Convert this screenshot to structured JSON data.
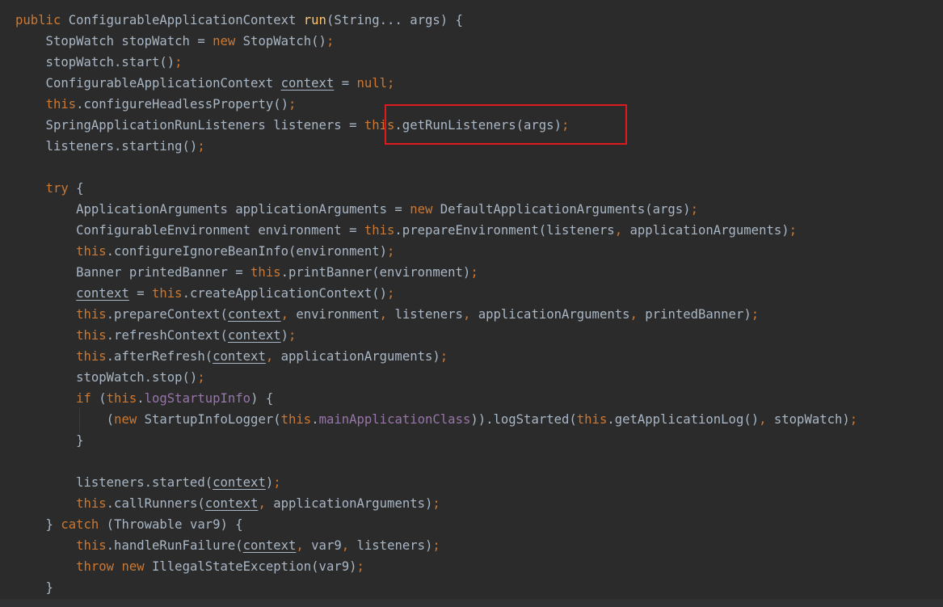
{
  "editor": {
    "highlight_color": "#e0191e",
    "colors": {
      "background": "#2b2b2b",
      "text": "#a9b7c6",
      "keyword": "#cc7832",
      "method_declaration": "#ffc66d",
      "field": "#9876aa"
    },
    "lines": [
      [
        {
          "t": "public",
          "c": "kw"
        },
        {
          "t": " ConfigurableApplicationContext "
        },
        {
          "t": "run",
          "c": "fn"
        },
        {
          "t": "(String... args) {"
        }
      ],
      [
        {
          "t": "    StopWatch stopWatch = "
        },
        {
          "t": "new",
          "c": "kw"
        },
        {
          "t": " StopWatch()"
        },
        {
          "t": ";",
          "c": "kw"
        }
      ],
      [
        {
          "t": "    stopWatch.start()"
        },
        {
          "t": ";",
          "c": "kw"
        }
      ],
      [
        {
          "t": "    ConfigurableApplicationContext "
        },
        {
          "t": "context",
          "c": "ul"
        },
        {
          "t": " = "
        },
        {
          "t": "null;",
          "c": "kw"
        }
      ],
      [
        {
          "t": "    "
        },
        {
          "t": "this",
          "c": "kw"
        },
        {
          "t": ".configureHeadlessProperty()"
        },
        {
          "t": ";",
          "c": "kw"
        }
      ],
      [
        {
          "t": "    SpringApplicationRunListeners listeners = "
        },
        {
          "t": "this",
          "c": "kw"
        },
        {
          "t": ".getRunListeners(args)"
        },
        {
          "t": ";",
          "c": "kw"
        }
      ],
      [
        {
          "t": "    listeners.starting()"
        },
        {
          "t": ";",
          "c": "kw"
        }
      ],
      [],
      [
        {
          "t": "    "
        },
        {
          "t": "try",
          "c": "kw"
        },
        {
          "t": " {"
        }
      ],
      [
        {
          "t": "        ApplicationArguments applicationArguments = "
        },
        {
          "t": "new",
          "c": "kw"
        },
        {
          "t": " DefaultApplicationArguments(args)"
        },
        {
          "t": ";",
          "c": "kw"
        }
      ],
      [
        {
          "t": "        ConfigurableEnvironment environment = "
        },
        {
          "t": "this",
          "c": "kw"
        },
        {
          "t": ".prepareEnvironment(listeners"
        },
        {
          "t": ",",
          "c": "kw"
        },
        {
          "t": " applicationArguments)"
        },
        {
          "t": ";",
          "c": "kw"
        }
      ],
      [
        {
          "t": "        "
        },
        {
          "t": "this",
          "c": "kw"
        },
        {
          "t": ".configureIgnoreBeanInfo(environment)"
        },
        {
          "t": ";",
          "c": "kw"
        }
      ],
      [
        {
          "t": "        Banner printedBanner = "
        },
        {
          "t": "this",
          "c": "kw"
        },
        {
          "t": ".printBanner(environment)"
        },
        {
          "t": ";",
          "c": "kw"
        }
      ],
      [
        {
          "t": "        "
        },
        {
          "t": "context",
          "c": "ul"
        },
        {
          "t": " = "
        },
        {
          "t": "this",
          "c": "kw"
        },
        {
          "t": ".createApplicationContext()"
        },
        {
          "t": ";",
          "c": "kw"
        }
      ],
      [
        {
          "t": "        "
        },
        {
          "t": "this",
          "c": "kw"
        },
        {
          "t": ".prepareContext("
        },
        {
          "t": "context",
          "c": "ul"
        },
        {
          "t": ",",
          "c": "kw"
        },
        {
          "t": " environment"
        },
        {
          "t": ",",
          "c": "kw"
        },
        {
          "t": " listeners"
        },
        {
          "t": ",",
          "c": "kw"
        },
        {
          "t": " applicationArguments"
        },
        {
          "t": ",",
          "c": "kw"
        },
        {
          "t": " printedBanner)"
        },
        {
          "t": ";",
          "c": "kw"
        }
      ],
      [
        {
          "t": "        "
        },
        {
          "t": "this",
          "c": "kw"
        },
        {
          "t": ".refreshContext("
        },
        {
          "t": "context",
          "c": "ul"
        },
        {
          "t": ")"
        },
        {
          "t": ";",
          "c": "kw"
        }
      ],
      [
        {
          "t": "        "
        },
        {
          "t": "this",
          "c": "kw"
        },
        {
          "t": ".afterRefresh("
        },
        {
          "t": "context",
          "c": "ul"
        },
        {
          "t": ",",
          "c": "kw"
        },
        {
          "t": " applicationArguments)"
        },
        {
          "t": ";",
          "c": "kw"
        }
      ],
      [
        {
          "t": "        stopWatch.stop()"
        },
        {
          "t": ";",
          "c": "kw"
        }
      ],
      [
        {
          "t": "        "
        },
        {
          "t": "if",
          "c": "kw"
        },
        {
          "t": " ("
        },
        {
          "t": "this",
          "c": "kw"
        },
        {
          "t": "."
        },
        {
          "t": "logStartupInfo",
          "c": "fld"
        },
        {
          "t": ") {"
        }
      ],
      [
        {
          "t": "            ("
        },
        {
          "t": "new",
          "c": "kw"
        },
        {
          "t": " StartupInfoLogger("
        },
        {
          "t": "this",
          "c": "kw"
        },
        {
          "t": "."
        },
        {
          "t": "mainApplicationClass",
          "c": "fld"
        },
        {
          "t": ")).logStarted("
        },
        {
          "t": "this",
          "c": "kw"
        },
        {
          "t": ".getApplicationLog()"
        },
        {
          "t": ",",
          "c": "kw"
        },
        {
          "t": " stopWatch)"
        },
        {
          "t": ";",
          "c": "kw"
        }
      ],
      [
        {
          "t": "        }"
        }
      ],
      [],
      [
        {
          "t": "        listeners.started("
        },
        {
          "t": "context",
          "c": "ul"
        },
        {
          "t": ")"
        },
        {
          "t": ";",
          "c": "kw"
        }
      ],
      [
        {
          "t": "        "
        },
        {
          "t": "this",
          "c": "kw"
        },
        {
          "t": ".callRunners("
        },
        {
          "t": "context",
          "c": "ul"
        },
        {
          "t": ",",
          "c": "kw"
        },
        {
          "t": " applicationArguments)"
        },
        {
          "t": ";",
          "c": "kw"
        }
      ],
      [
        {
          "t": "    } "
        },
        {
          "t": "catch",
          "c": "kw"
        },
        {
          "t": " (Throwable var9) {"
        }
      ],
      [
        {
          "t": "        "
        },
        {
          "t": "this",
          "c": "kw"
        },
        {
          "t": ".handleRunFailure("
        },
        {
          "t": "context",
          "c": "ul"
        },
        {
          "t": ",",
          "c": "kw"
        },
        {
          "t": " var9"
        },
        {
          "t": ",",
          "c": "kw"
        },
        {
          "t": " listeners)"
        },
        {
          "t": ";",
          "c": "kw"
        }
      ],
      [
        {
          "t": "        "
        },
        {
          "t": "throw",
          "c": "kw"
        },
        {
          "t": " "
        },
        {
          "t": "new",
          "c": "kw"
        },
        {
          "t": " IllegalStateException(var9)"
        },
        {
          "t": ";",
          "c": "kw"
        }
      ],
      [
        {
          "t": "    }"
        }
      ]
    ]
  }
}
